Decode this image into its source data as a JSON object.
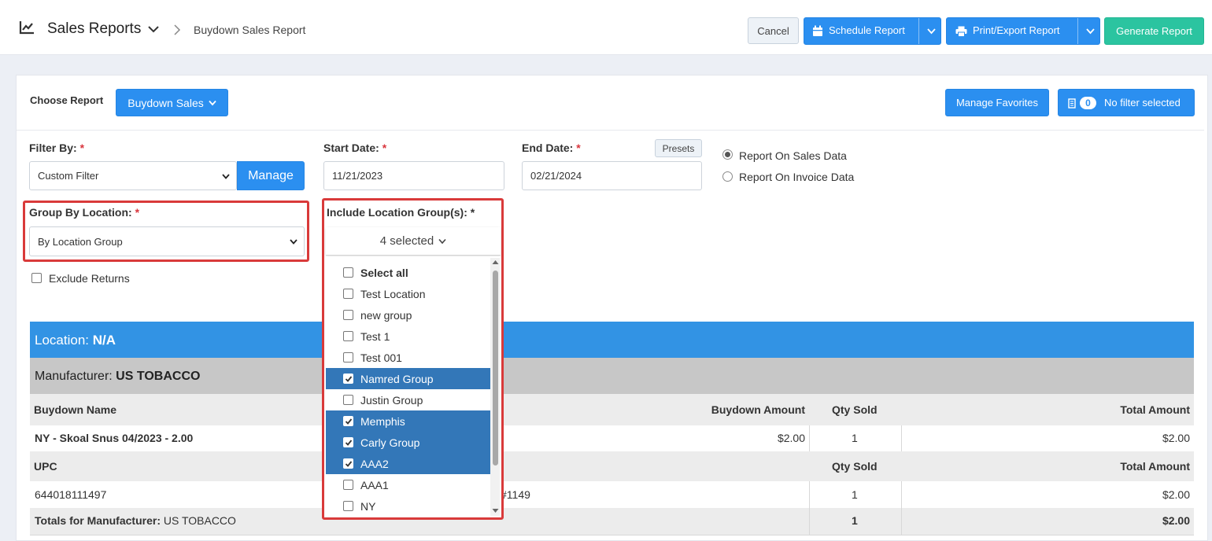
{
  "header": {
    "title": "Sales Reports",
    "breadcrumb": "Buydown Sales Report",
    "cancel_label": "Cancel",
    "schedule_label": "Schedule Report",
    "print_label": "Print/Export Report",
    "generate_label": "Generate Report"
  },
  "toolbar": {
    "choose_report_label": "Choose Report",
    "report_value": "Buydown Sales",
    "manage_favorites_label": "Manage Favorites",
    "filter_count": "0",
    "no_filter_label": "No filter selected"
  },
  "form": {
    "filter_by_label": "Filter By:",
    "filter_by_value": "Custom Filter",
    "manage_label": "Manage",
    "start_date_label": "Start Date:",
    "start_date_value": "11/21/2023",
    "end_date_label": "End Date:",
    "end_date_value": "02/21/2024",
    "presets_label": "Presets",
    "radio_sales": "Report On Sales Data",
    "radio_invoice": "Report On Invoice Data",
    "selected_radio": "sales",
    "group_by_label": "Group By Location:",
    "group_by_value": "By Location Group",
    "exclude_returns_label": "Exclude Returns",
    "include_groups_label": "Include Location Group(s):",
    "required_mark": "*"
  },
  "dropdown": {
    "toggle_label": "4 selected",
    "select_all_label": "Select all",
    "items": [
      {
        "label": "Test Location",
        "checked": false
      },
      {
        "label": "new group",
        "checked": false
      },
      {
        "label": "Test 1",
        "checked": false
      },
      {
        "label": "Test 001",
        "checked": false
      },
      {
        "label": "Namred Group",
        "checked": true
      },
      {
        "label": "Justin Group",
        "checked": false
      },
      {
        "label": "Memphis",
        "checked": true
      },
      {
        "label": "Carly Group",
        "checked": true
      },
      {
        "label": "AAA2",
        "checked": true
      },
      {
        "label": "AAA1",
        "checked": false
      },
      {
        "label": "NY",
        "checked": false
      }
    ]
  },
  "report": {
    "location_label": "Location:",
    "location_value": "N/A",
    "manufacturer_label": "Manufacturer:",
    "manufacturer_value": "US TOBACCO",
    "col_buydown_name": "Buydown Name",
    "col_buydown_amount": "Buydown Amount",
    "col_qty_sold": "Qty Sold",
    "col_total_amount": "Total Amount",
    "buydown_row": {
      "name": "NY - Skoal Snus 04/2023 - 2.00",
      "amount": "$2.00",
      "qty": "1",
      "total": "$2.00"
    },
    "col_upc": "UPC",
    "col_qty_sold_2": "Qty Sold",
    "col_total_amount_2": "Total Amount",
    "upc_row": {
      "upc": "644018111497",
      "desc_tail": "#1149",
      "qty": "1",
      "total": "$2.00"
    },
    "totals_label": "Totals for Manufacturer:",
    "totals_value": "US TOBACCO",
    "totals_qty": "1",
    "totals_amount": "$2.00"
  },
  "colors": {
    "primary": "#2b8ff0",
    "success": "#2bc4a0",
    "location_bar": "#3293e4",
    "selected_item": "#3377b8",
    "highlight_border": "#d93a3a"
  }
}
